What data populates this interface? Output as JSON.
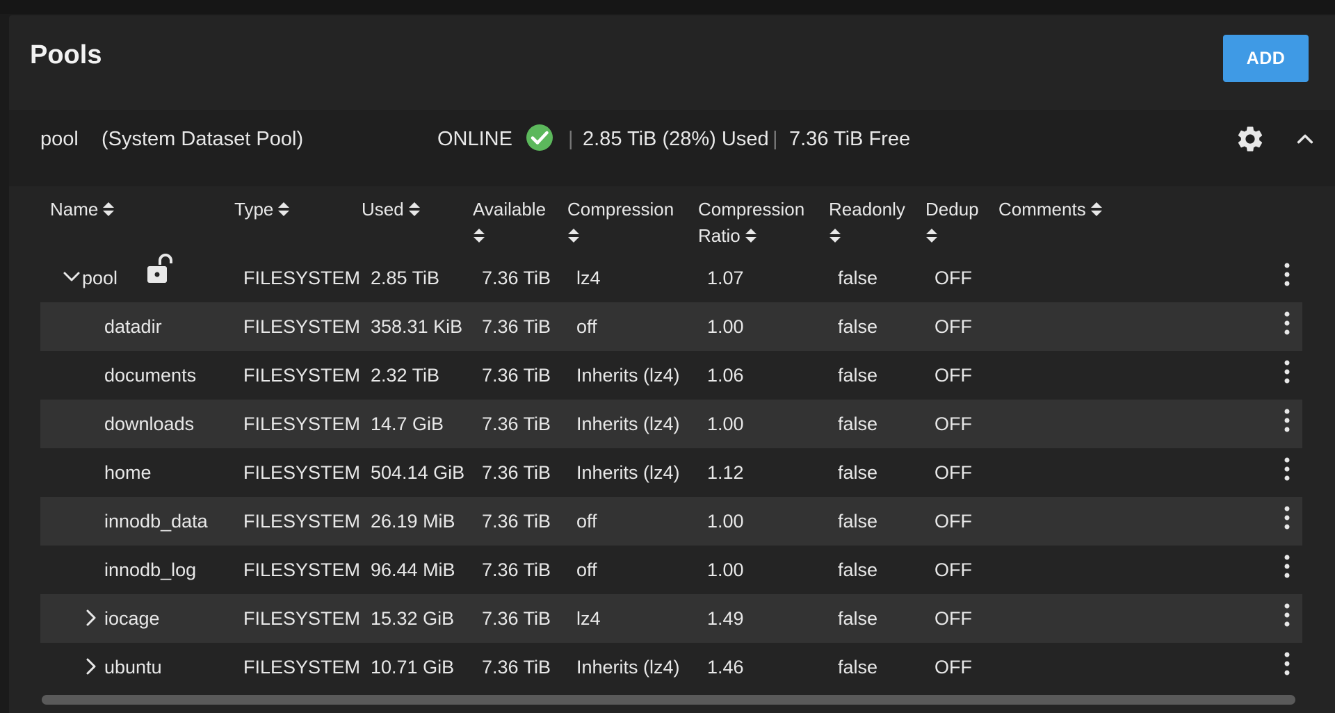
{
  "page": {
    "title": "Pools",
    "add_label": "ADD"
  },
  "pool_header": {
    "name": "pool",
    "tag": "(System Dataset Pool)",
    "status": "ONLINE",
    "used": "2.85 TiB (28%) Used",
    "free": "7.36 TiB Free",
    "separator": "|",
    "status_color": "#5cb85c"
  },
  "columns": [
    {
      "line1": "Name",
      "line2": ""
    },
    {
      "line1": "Type",
      "line2": ""
    },
    {
      "line1": "Used",
      "line2": ""
    },
    {
      "line1": "Available",
      "line2": ""
    },
    {
      "line1": "Compression",
      "line2": ""
    },
    {
      "line1": "Compression",
      "line2": "Ratio"
    },
    {
      "line1": "Readonly",
      "line2": ""
    },
    {
      "line1": "Dedup",
      "line2": ""
    },
    {
      "line1": "Comments",
      "line2": ""
    }
  ],
  "rows": [
    {
      "name": "pool",
      "type": "FILESYSTEM",
      "used": "2.85 TiB",
      "available": "7.36 TiB",
      "compression": "lz4",
      "ratio": "1.07",
      "readonly": "false",
      "dedup": "OFF",
      "comments": ""
    },
    {
      "name": "datadir",
      "type": "FILESYSTEM",
      "used": "358.31 KiB",
      "available": "7.36 TiB",
      "compression": "off",
      "ratio": "1.00",
      "readonly": "false",
      "dedup": "OFF",
      "comments": ""
    },
    {
      "name": "documents",
      "type": "FILESYSTEM",
      "used": "2.32 TiB",
      "available": "7.36 TiB",
      "compression": "Inherits (lz4)",
      "ratio": "1.06",
      "readonly": "false",
      "dedup": "OFF",
      "comments": ""
    },
    {
      "name": "downloads",
      "type": "FILESYSTEM",
      "used": "14.7 GiB",
      "available": "7.36 TiB",
      "compression": "Inherits (lz4)",
      "ratio": "1.00",
      "readonly": "false",
      "dedup": "OFF",
      "comments": ""
    },
    {
      "name": "home",
      "type": "FILESYSTEM",
      "used": "504.14 GiB",
      "available": "7.36 TiB",
      "compression": "Inherits (lz4)",
      "ratio": "1.12",
      "readonly": "false",
      "dedup": "OFF",
      "comments": ""
    },
    {
      "name": "innodb_data",
      "type": "FILESYSTEM",
      "used": "26.19 MiB",
      "available": "7.36 TiB",
      "compression": "off",
      "ratio": "1.00",
      "readonly": "false",
      "dedup": "OFF",
      "comments": ""
    },
    {
      "name": "innodb_log",
      "type": "FILESYSTEM",
      "used": "96.44 MiB",
      "available": "7.36 TiB",
      "compression": "off",
      "ratio": "1.00",
      "readonly": "false",
      "dedup": "OFF",
      "comments": ""
    },
    {
      "name": "iocage",
      "type": "FILESYSTEM",
      "used": "15.32 GiB",
      "available": "7.36 TiB",
      "compression": "lz4",
      "ratio": "1.49",
      "readonly": "false",
      "dedup": "OFF",
      "comments": ""
    },
    {
      "name": "ubuntu",
      "type": "FILESYSTEM",
      "used": "10.71 GiB",
      "available": "7.36 TiB",
      "compression": "Inherits (lz4)",
      "ratio": "1.46",
      "readonly": "false",
      "dedup": "OFF",
      "comments": ""
    }
  ],
  "icons": {
    "status": "check-circle-icon",
    "settings": "gear-icon",
    "collapse": "chevron-up-icon",
    "expanded": "chevron-down-icon",
    "collapsed": "chevron-right-icon",
    "unlocked": "lock-open-icon",
    "actions": "more-vert-icon",
    "sort": "sort-icon"
  }
}
